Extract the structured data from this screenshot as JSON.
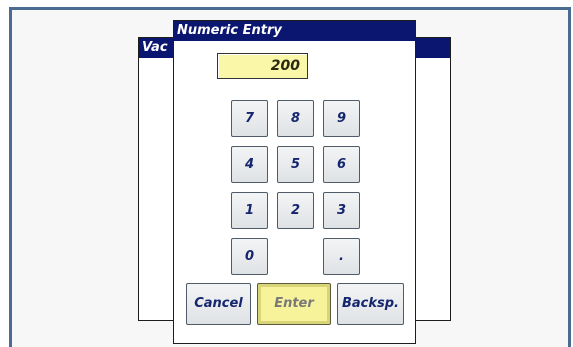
{
  "background_window": {
    "title": "Vac"
  },
  "dialog": {
    "title": "Numeric Entry",
    "value": "200"
  },
  "keypad": {
    "k7": "7",
    "k8": "8",
    "k9": "9",
    "k4": "4",
    "k5": "5",
    "k6": "6",
    "k1": "1",
    "k2": "2",
    "k3": "3",
    "k0": "0",
    "kdot": "."
  },
  "actions": {
    "cancel": "Cancel",
    "enter": "Enter",
    "backspace": "Backsp."
  },
  "colors": {
    "titlebar": "#0b1670",
    "frame_border": "#4a6c92",
    "display_bg": "#fbf7a8",
    "enter_bg": "#f6f39a",
    "key_text": "#15266e"
  }
}
